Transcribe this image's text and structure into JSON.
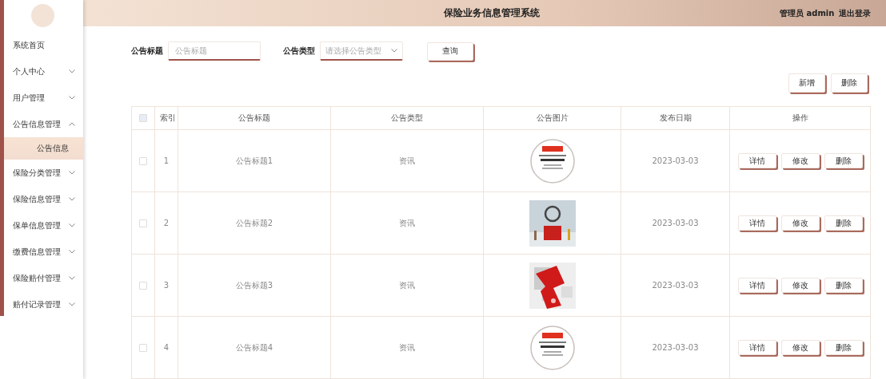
{
  "header": {
    "title": "保险业务信息管理系统",
    "user": "管理员 admin",
    "logout": "退出登录"
  },
  "sidebar": {
    "items": [
      {
        "label": "系统首页"
      },
      {
        "label": "个人中心",
        "expanded": false
      },
      {
        "label": "用户管理",
        "expanded": false
      },
      {
        "label": "公告信息管理",
        "expanded": true,
        "children": [
          {
            "label": "公告信息",
            "selected": true
          }
        ]
      },
      {
        "label": "保险分类管理",
        "expanded": false
      },
      {
        "label": "保险信息管理",
        "expanded": false
      },
      {
        "label": "保单信息管理",
        "expanded": false
      },
      {
        "label": "缴费信息管理",
        "expanded": false
      },
      {
        "label": "保险赔付管理",
        "expanded": false
      },
      {
        "label": "赔付记录管理",
        "expanded": false
      }
    ]
  },
  "search": {
    "fields": [
      {
        "kind": "text",
        "label": "公告标题",
        "placeholder": "公告标题"
      },
      {
        "kind": "select",
        "label": "公告类型",
        "placeholder": "请选择公告类型"
      }
    ],
    "button": "查询"
  },
  "actions": [
    "新增",
    "删除"
  ],
  "table": {
    "header_checked": false,
    "columns": [
      "索引",
      "公告标题",
      "公告类型",
      "公告图片",
      "发布日期",
      "操作"
    ],
    "rows": [
      {
        "checked": false,
        "index": "1",
        "title": "公告标题1",
        "type": "资讯",
        "image": {
          "kind": "picture"
        },
        "date": "2023-03-03",
        "buttons": [
          "详情",
          "修改",
          "删除"
        ]
      },
      {
        "checked": false,
        "index": "2",
        "title": "公告标题2",
        "type": "资讯",
        "image": {
          "kind": "picture"
        },
        "date": "2023-03-03",
        "buttons": [
          "详情",
          "修改",
          "删除"
        ]
      },
      {
        "checked": false,
        "index": "3",
        "title": "公告标题3",
        "type": "资讯",
        "image": {
          "kind": "picture"
        },
        "date": "2023-03-03",
        "buttons": [
          "详情",
          "修改",
          "删除"
        ]
      },
      {
        "checked": false,
        "index": "4",
        "title": "公告标题4",
        "type": "资讯",
        "image": {
          "kind": "picture"
        },
        "date": "2023-03-03",
        "buttons": [
          "详情",
          "修改",
          "删除"
        ]
      }
    ]
  }
}
